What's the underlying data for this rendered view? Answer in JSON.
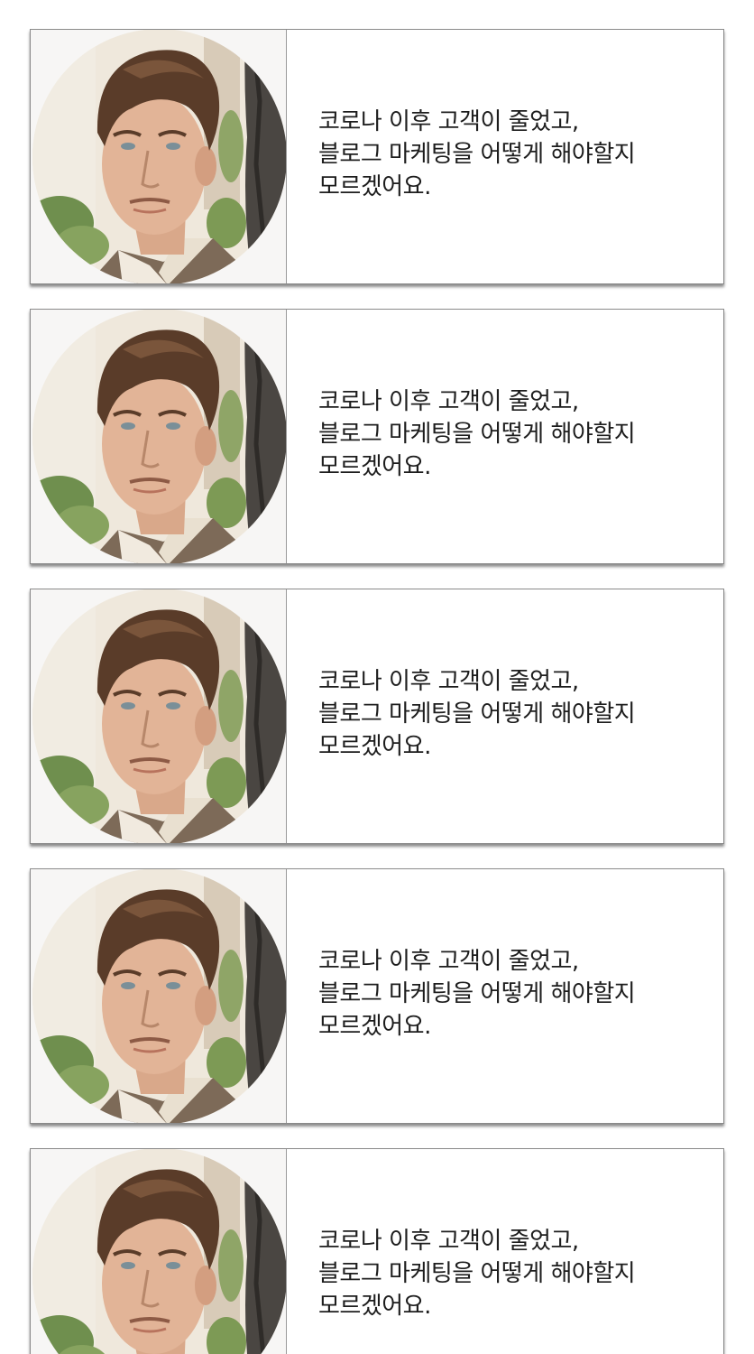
{
  "testimonials": [
    {
      "quote": "코로나 이후 고객이 줄었고,\n블로그 마케팅을 어떻게 해야할지\n모르겠어요.",
      "photo_icon": "customer-portrait"
    },
    {
      "quote": "코로나 이후 고객이 줄었고,\n블로그 마케팅을 어떻게 해야할지\n모르겠어요.",
      "photo_icon": "customer-portrait"
    },
    {
      "quote": "코로나 이후 고객이 줄었고,\n블로그 마케팅을 어떻게 해야할지\n모르겠어요.",
      "photo_icon": "customer-portrait"
    },
    {
      "quote": "코로나 이후 고객이 줄었고,\n블로그 마케팅을 어떻게 해야할지\n모르겠어요.",
      "photo_icon": "customer-portrait"
    },
    {
      "quote": "코로나 이후 고객이 줄었고,\n블로그 마케팅을 어떻게 해야할지\n모르겠어요.",
      "photo_icon": "customer-portrait"
    }
  ]
}
